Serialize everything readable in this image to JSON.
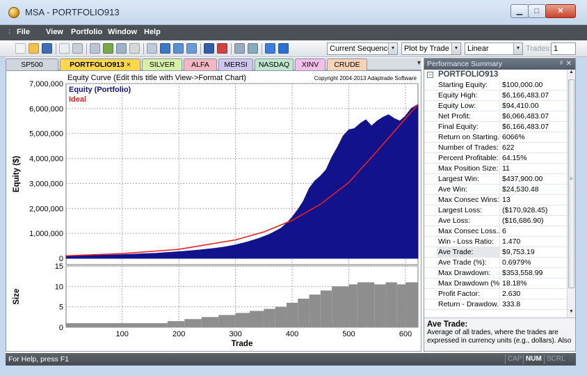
{
  "window": {
    "title": "MSA - PORTFOLIO913",
    "minimize": "▁",
    "maximize": "□",
    "close": "✕"
  },
  "menu": [
    "File",
    "View",
    "Portfolio",
    "Window",
    "Help"
  ],
  "toolbar": {
    "icons": [
      "new-icon",
      "open-icon",
      "save-icon",
      "copy-icon",
      "print-icon",
      "edit-icon",
      "chart-icon",
      "table-icon",
      "calc-icon",
      "report-icon",
      "bar-chart-icon",
      "stats-icon",
      "monitor-icon",
      "grid-icon",
      "window-icon",
      "zoom-in-icon",
      "zoom-out-icon",
      "help-icon",
      "info-icon"
    ],
    "sequence": "Current Sequence",
    "plot_mode": "Plot by Trade",
    "scale": "Linear",
    "trades_label": "Trades:",
    "trades_value": "1"
  },
  "tabs": [
    {
      "label": "SP500",
      "color": "#d0d6de"
    },
    {
      "label": "PORTFOLIO913",
      "color": "#ffd84a",
      "active": true,
      "close": "×"
    },
    {
      "label": "SILVER",
      "color": "#d6f0a8"
    },
    {
      "label": "ALFA",
      "color": "#f5b8c2"
    },
    {
      "label": "MERSI",
      "color": "#cfc5ef"
    },
    {
      "label": "NASDAQ",
      "color": "#bfe6cf"
    },
    {
      "label": "XINV",
      "color": "#f3bfe8"
    },
    {
      "label": "CRUDE",
      "color": "#f7d2b4"
    }
  ],
  "chart_data": {
    "type": "area",
    "title": "Equity Curve (Edit this title with View->Format Chart)",
    "copyright": "Copyright 2004-2013 Adaptrade Software",
    "xlabel": "Trade",
    "ylabel": "Equity ($)",
    "xlim": [
      1,
      622
    ],
    "ylim": [
      -250000,
      7000000
    ],
    "x_ticks": [
      "100",
      "200",
      "300",
      "400",
      "500",
      "600"
    ],
    "x_tick_values": [
      100,
      200,
      300,
      400,
      500,
      600
    ],
    "y_ticks": [
      "0",
      "1,000,000",
      "2,000,000",
      "3,000,000",
      "4,000,000",
      "5,000,000",
      "6,000,000",
      "7,000,000"
    ],
    "y_tick_values": [
      0,
      1000000,
      2000000,
      3000000,
      4000000,
      5000000,
      6000000,
      7000000
    ],
    "grid": true,
    "legend": "top-left",
    "series": [
      {
        "name": "Equity (Portfolio)",
        "color": "#12128c",
        "x": [
          1,
          20,
          40,
          60,
          80,
          100,
          120,
          140,
          160,
          180,
          200,
          220,
          240,
          260,
          280,
          300,
          320,
          340,
          360,
          380,
          390,
          400,
          410,
          420,
          430,
          440,
          450,
          460,
          470,
          480,
          490,
          500,
          510,
          520,
          530,
          540,
          550,
          560,
          570,
          580,
          590,
          600,
          610,
          622
        ],
        "y": [
          100000,
          110000,
          118000,
          125000,
          135000,
          150000,
          165000,
          185000,
          205000,
          235000,
          265000,
          300000,
          340000,
          390000,
          450000,
          540000,
          650000,
          790000,
          960000,
          1200000,
          1400000,
          1650000,
          1950000,
          2300000,
          2800000,
          3100000,
          3300000,
          3550000,
          4050000,
          4450000,
          4900000,
          5150000,
          5200000,
          5400000,
          5550000,
          5300000,
          5500000,
          5650000,
          5750000,
          5600000,
          5500000,
          5700000,
          6000000,
          6166483
        ]
      },
      {
        "name": "Ideal",
        "color": "#e82020",
        "x": [
          1,
          100,
          200,
          300,
          350,
          400,
          450,
          500,
          550,
          600,
          622
        ],
        "y": [
          100000,
          190000,
          360000,
          740000,
          1060000,
          1520000,
          2170000,
          3040000,
          4300000,
          5600000,
          6166483
        ]
      }
    ],
    "size_panel": {
      "type": "bar",
      "ylabel": "Size",
      "ylim": [
        0,
        15
      ],
      "y_ticks": [
        "0",
        "5",
        "10",
        "15"
      ],
      "y_tick_values": [
        0,
        5,
        10,
        15
      ],
      "color": "#8e8e8e",
      "steps": [
        {
          "x": 1,
          "v": 1
        },
        {
          "x": 180,
          "v": 1.5
        },
        {
          "x": 210,
          "v": 2
        },
        {
          "x": 240,
          "v": 2.5
        },
        {
          "x": 270,
          "v": 3
        },
        {
          "x": 300,
          "v": 3.5
        },
        {
          "x": 325,
          "v": 4
        },
        {
          "x": 350,
          "v": 4.5
        },
        {
          "x": 370,
          "v": 5
        },
        {
          "x": 390,
          "v": 6
        },
        {
          "x": 410,
          "v": 7
        },
        {
          "x": 430,
          "v": 8
        },
        {
          "x": 450,
          "v": 9
        },
        {
          "x": 470,
          "v": 10
        },
        {
          "x": 500,
          "v": 10.5
        },
        {
          "x": 515,
          "v": 11
        },
        {
          "x": 545,
          "v": 10.5
        },
        {
          "x": 565,
          "v": 11
        },
        {
          "x": 585,
          "v": 10.5
        },
        {
          "x": 600,
          "v": 11
        }
      ]
    }
  },
  "performance": {
    "title": "Performance Summary",
    "pin": "ᵖ",
    "close": "✕",
    "group": "PORTFOLIO913",
    "rows": [
      {
        "label": "Starting Equity:",
        "value": "$100,000.00"
      },
      {
        "label": "Equity High:",
        "value": "$6,166,483.07"
      },
      {
        "label": "Equity Low:",
        "value": "$94,410.00"
      },
      {
        "label": "Net Profit:",
        "value": "$6,066,483.07"
      },
      {
        "label": "Final Equity:",
        "value": "$6,166,483.07"
      },
      {
        "label": "Return on Starting...",
        "value": "6066%"
      },
      {
        "label": "Number of Trades:",
        "value": "622"
      },
      {
        "label": "Percent Profitable:",
        "value": "64.15%"
      },
      {
        "label": "Max Position Size:",
        "value": "11"
      },
      {
        "label": "Largest Win:",
        "value": "$437,900.00"
      },
      {
        "label": "Ave Win:",
        "value": "$24,530.48"
      },
      {
        "label": "Max Consec Wins:",
        "value": "13"
      },
      {
        "label": "Largest Loss:",
        "value": "($170,928.45)"
      },
      {
        "label": "Ave Loss:",
        "value": "($16,686.90)"
      },
      {
        "label": "Max Consec Loss...",
        "value": "6"
      },
      {
        "label": "Win - Loss Ratio:",
        "value": "1.470"
      },
      {
        "label": "Ave Trade:",
        "value": "$9,753.19",
        "selected": true
      },
      {
        "label": "Ave Trade (%):",
        "value": "0.6979%"
      },
      {
        "label": "Max Drawdown:",
        "value": "$353,558.99"
      },
      {
        "label": "Max Drawdown (%):",
        "value": "18.18%"
      },
      {
        "label": "Profit Factor:",
        "value": "2.630"
      },
      {
        "label": "Return - Drawdow...",
        "value": "333.8"
      }
    ],
    "desc_title": "Ave Trade:",
    "desc_text": "Average of all trades, where the trades are expressed in currency units (e.g., dollars). Also"
  },
  "status": {
    "text": "For Help, press F1",
    "indicators": [
      {
        "label": "CAP",
        "on": false
      },
      {
        "label": "NUM",
        "on": true
      },
      {
        "label": "SCRL",
        "on": false
      }
    ]
  }
}
